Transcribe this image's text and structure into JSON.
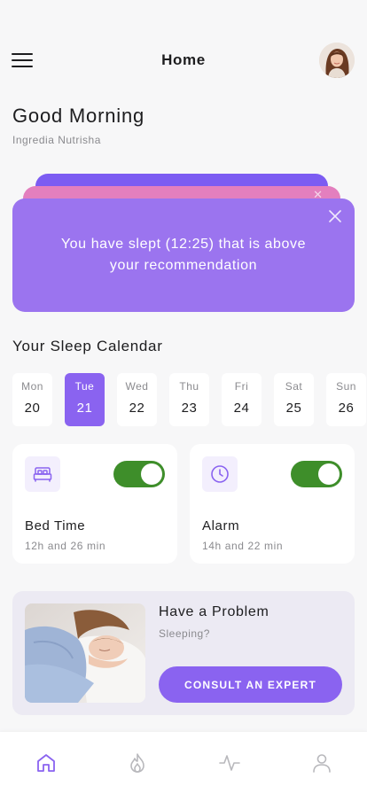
{
  "header": {
    "title": "Home",
    "menu_icon": "hamburger-icon",
    "avatar_icon": "user-avatar"
  },
  "greeting": {
    "title": "Good Morning",
    "name": "Ingredia Nutrisha"
  },
  "notice": {
    "text": "You have slept (12:25) that is above your recommendation",
    "close_icon": "close-icon"
  },
  "calendar": {
    "title": "Your Sleep Calendar",
    "days": [
      {
        "name": "Mon",
        "date": "20"
      },
      {
        "name": "Tue",
        "date": "21"
      },
      {
        "name": "Wed",
        "date": "22"
      },
      {
        "name": "Thu",
        "date": "23"
      },
      {
        "name": "Fri",
        "date": "24"
      },
      {
        "name": "Sat",
        "date": "25"
      },
      {
        "name": "Sun",
        "date": "26"
      }
    ],
    "selected": "Tue"
  },
  "cards": {
    "bedtime": {
      "label": "Bed Time",
      "value": "12h and 26 min",
      "icon": "bed-icon",
      "enabled": true
    },
    "alarm": {
      "label": "Alarm",
      "value": "14h and 22 min",
      "icon": "clock-icon",
      "enabled": true
    }
  },
  "problem": {
    "title": "Have a Problem",
    "subtitle": "Sleeping?",
    "button": "CONSULT AN EXPERT"
  },
  "tabbar": {
    "items": [
      "home-icon",
      "flame-icon",
      "activity-icon",
      "profile-icon"
    ],
    "active": "home-icon"
  },
  "colors": {
    "accent": "#8a63f0",
    "notice": "#9b74ef",
    "toggle_on": "#3e8e2a",
    "pink": "#e37fbe"
  }
}
